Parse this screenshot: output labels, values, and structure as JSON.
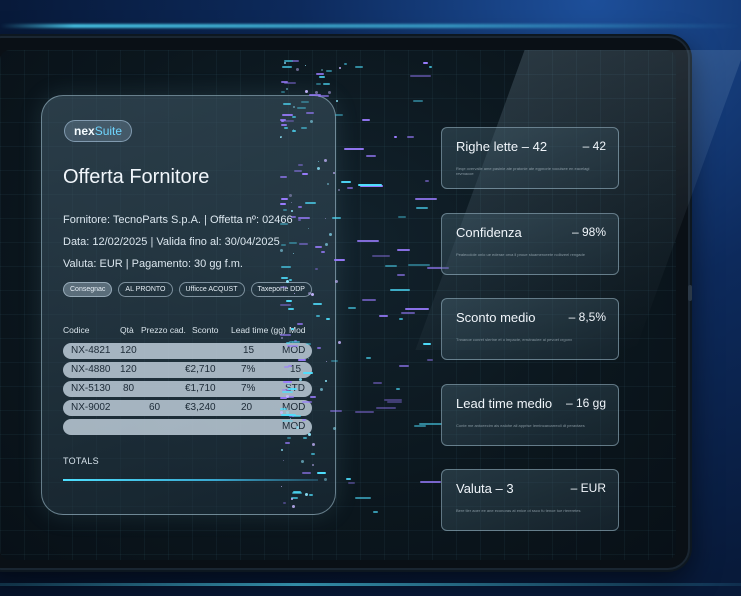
{
  "document": {
    "logo": {
      "part1": "nex",
      "part2": "Suite"
    },
    "title": "Offerta Fornitore",
    "lines": [
      "Fornitore: TecnoParts S.p.A.  |  Offetta nº: 02466",
      "Data: 12/02/2025  |  Valida fino al: 30/04/2025",
      "Valuta: EUR  |  Pagamento: 30 gg f.m."
    ],
    "tags": [
      "Consegnac",
      "AL PRONTO",
      "Ufficce ACQUST",
      "Taxeporte DDP"
    ],
    "table": {
      "headers": [
        "Codice",
        "Qtà",
        "Prezzo cad.",
        "Sconto",
        "Lead time (gg)",
        "Mod"
      ],
      "rows": [
        [
          "NX-4821",
          "120",
          "",
          "",
          "15",
          "MOD"
        ],
        [
          "NX-4880",
          "120",
          "€2,710",
          "7%",
          "15",
          ""
        ],
        [
          "NX-5130",
          "80",
          "€1,710",
          "7%",
          "STD",
          ""
        ],
        [
          "NX-9002",
          "60",
          "€3,240",
          "20",
          "MOD",
          ""
        ],
        [
          "",
          "",
          "",
          "",
          "",
          "MOD"
        ]
      ]
    },
    "totals_label": "TOTALS"
  },
  "stats": [
    {
      "label": "Righe lette – 42",
      "value": "– 42",
      "desc": "Reqe overvalie ame pasinie ate pratonie ate egpnorie vocuisee en eacelagi revmacoe"
    },
    {
      "label": "Confidenza",
      "value": "– 98%",
      "desc": "Pealecolole onlo ue ederae orva il proue stuameroeete nolbzeel rengade"
    },
    {
      "label": "Sconto medio",
      "value": "– 8,5%",
      "desc": "Tnnanoe conret slertne et o impacte, errutrauiee ai pevoet crgonx"
    },
    {
      "label": "Lead time medio",
      "value": "– 16 gg",
      "desc": "Conte me antoeecim ais ealohe ail apprise Iemtncaroarreoli dt peravtaes"
    },
    {
      "label": "Valuta – 3",
      "value": "– EUR",
      "desc": "Bere tler aoer ee ane econoras at enice ot ssco fu tenoe tue rtereretes"
    }
  ],
  "colors": {
    "accent": "#4fe0ff",
    "particle_violet": "#9a7cff",
    "background": "#0b161d"
  }
}
